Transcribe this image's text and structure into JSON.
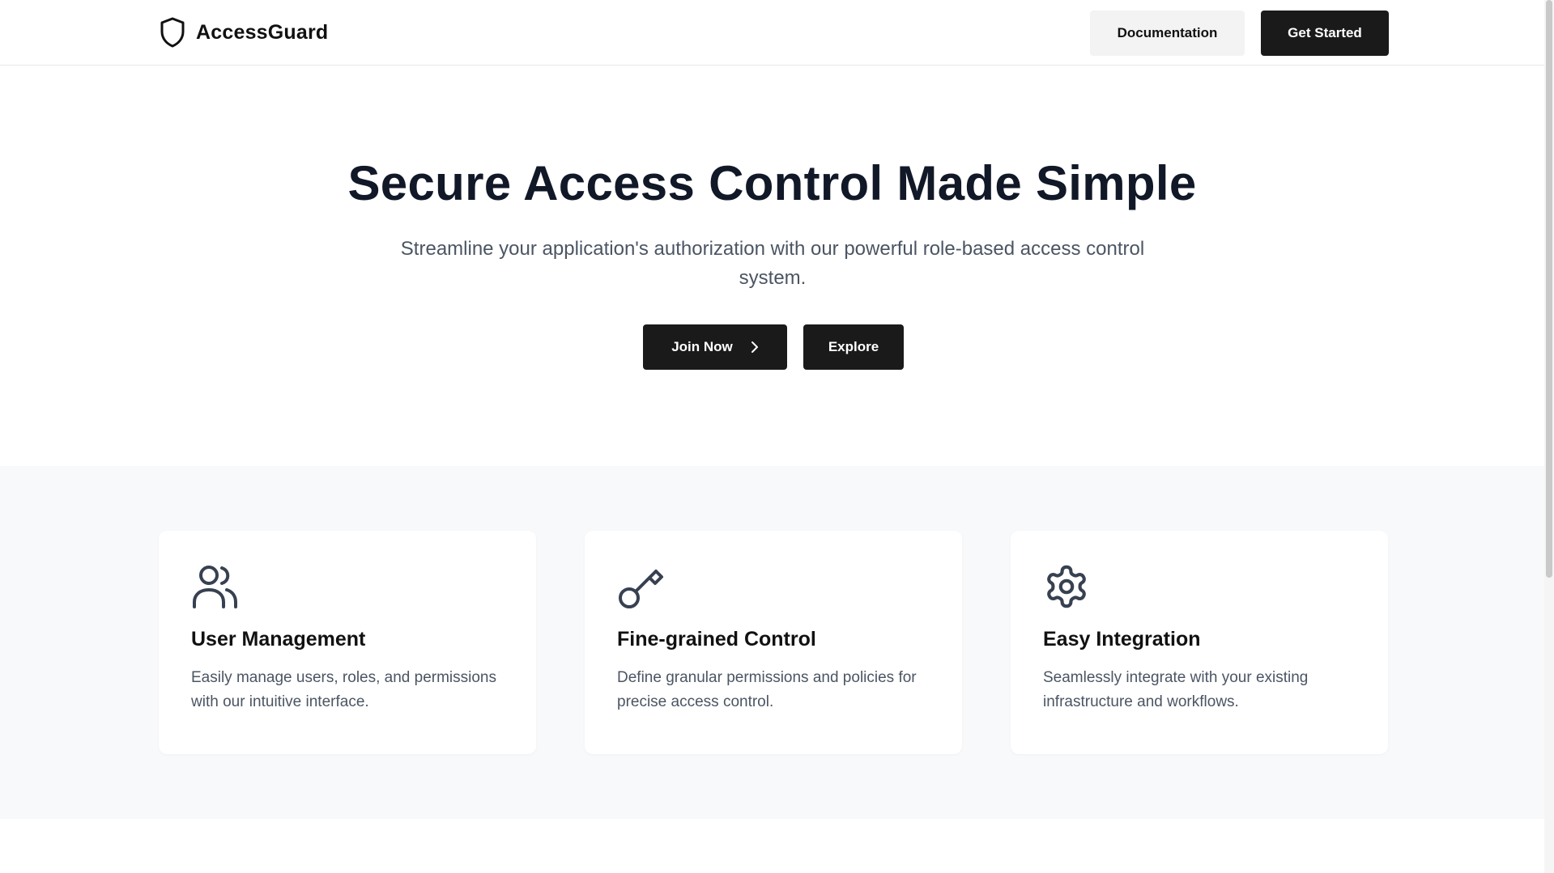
{
  "header": {
    "brand_name": "AccessGuard",
    "doc_label": "Documentation",
    "get_started_label": "Get Started"
  },
  "hero": {
    "title": "Secure Access Control Made Simple",
    "subtitle": "Streamline your application's authorization with our powerful role-based access control system.",
    "join_label": "Join Now",
    "explore_label": "Explore"
  },
  "features": [
    {
      "icon": "users-icon",
      "title": "User Management",
      "description": "Easily manage users, roles, and permissions with our intuitive interface."
    },
    {
      "icon": "key-icon",
      "title": "Fine-grained Control",
      "description": "Define granular permissions and policies for precise access control."
    },
    {
      "icon": "gear-icon",
      "title": "Easy Integration",
      "description": "Seamlessly integrate with your existing infrastructure and workflows."
    }
  ],
  "colors": {
    "primary_dark": "#1a1a1a",
    "secondary_button": "#f3f3f3",
    "heading": "#111827",
    "body_text": "#4b5563",
    "features_bg": "#f8f9fb",
    "icon_stroke": "#374151"
  }
}
